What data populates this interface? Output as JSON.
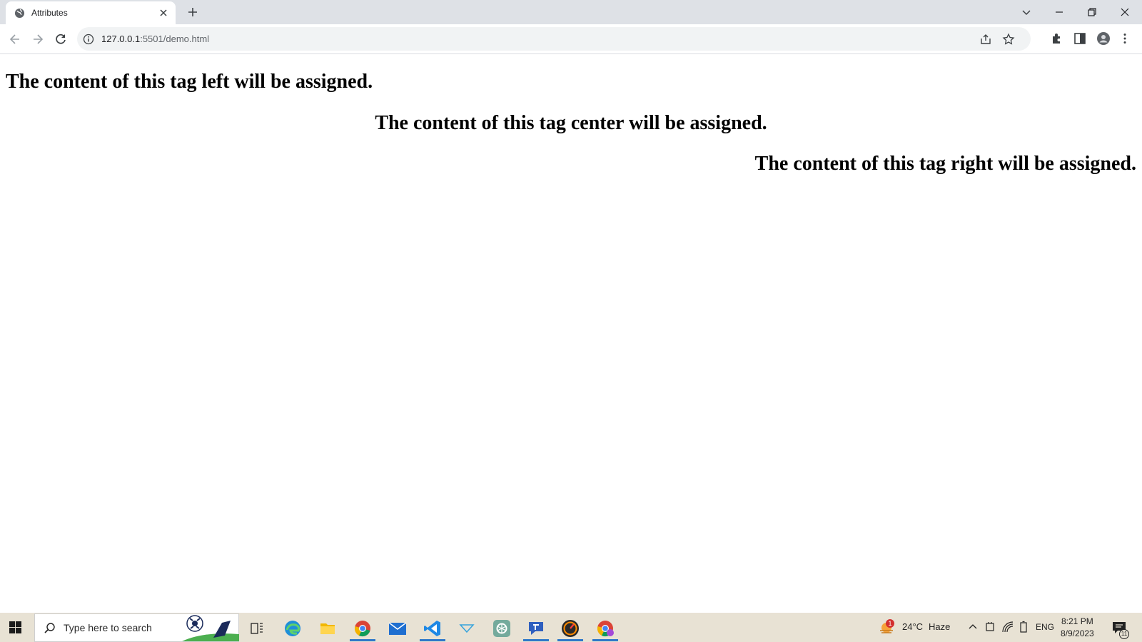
{
  "browser": {
    "tab": {
      "title": "Attributes"
    },
    "address": {
      "host": "127.0.0.1",
      "path": ":5501/demo.html"
    }
  },
  "page": {
    "heading_left": "The content of this tag left will be assigned.",
    "heading_center": "The content of this tag center will be assigned.",
    "heading_right": "The content of this tag right will be assigned."
  },
  "taskbar": {
    "search_placeholder": "Type here to search",
    "weather": {
      "temp": "24°C",
      "condition": "Haze",
      "badge": "1"
    },
    "language": "ENG",
    "time": "8:21 PM",
    "date": "8/9/2023",
    "notification_count": "11",
    "apps": [
      "task-view-icon",
      "edge-icon",
      "file-explorer-icon",
      "chrome-icon",
      "mail-icon",
      "vscode-icon",
      "app-icon",
      "chatgpt-icon",
      "teams-icon",
      "wpm-icon",
      "chrome-profile-icon"
    ]
  }
}
